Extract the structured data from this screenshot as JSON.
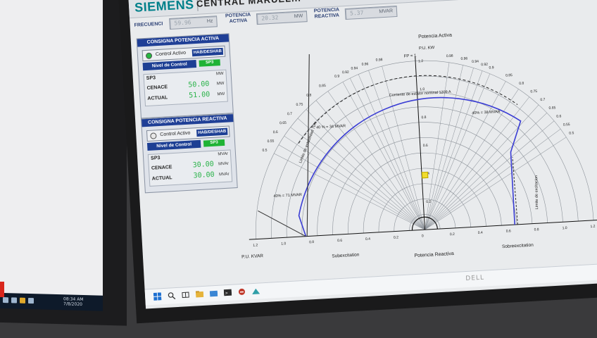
{
  "left_monitor": {
    "taskbar_time": "08:34 AM",
    "taskbar_date": "7/8/2020"
  },
  "header": {
    "brand": "SIEMENS",
    "title": "CENTRAL MARUEL..."
  },
  "measurements": {
    "frecuencia": {
      "label": "FRECUENCI",
      "value": "59.96",
      "unit": "Hz"
    },
    "potencia_activa": {
      "label": "POTENCIA ACTIVA",
      "value": "20.32",
      "unit": "MW"
    },
    "potencia_reactiva": {
      "label": "POTENCIA REACTIVA",
      "value": "5.37",
      "unit": "MVAR"
    }
  },
  "active_power_panel": {
    "title": "CONSIGNA POTENCIA ACTIVA",
    "control_label": "Control Activo",
    "control_on": true,
    "hab_label": "HAB/DESHAB",
    "level_label": "Nivel de Control",
    "level_value": "SP3",
    "sp_label": "SP3",
    "cenace_label": "CENACE",
    "cenace_value": "50.00",
    "actual_label": "ACTUAL",
    "actual_value": "51.00",
    "unit": "MW"
  },
  "reactive_power_panel": {
    "title": "CONSIGNA POTENCIA REACTIVA",
    "control_label": "Control Activo",
    "control_on": false,
    "hab_label": "HAB/DESHAB",
    "level_label": "Nivel de Control",
    "level_value": "SP3",
    "sp_label": "SP3",
    "cenace_label": "CENACE",
    "cenace_value": "30.00",
    "actual_label": "ACTUAL",
    "actual_value": "30.00",
    "unit": "MVAr"
  },
  "chart": {
    "title": "Potencia Activa",
    "y_axis_label": "P.U. KW",
    "fp_label": "FP = 1",
    "x_axis_label": "P.U. KVAR",
    "x_title": "Potencia Reactiva",
    "left_region": "Subexcitation",
    "right_region": "Sobreexcitation",
    "curve_current_label": "Corriente de estator nominal 1209 A",
    "curve_left_label": "40 % = 34 MVAR",
    "curve_right_label": "40% = 38 MVAR",
    "curve_low_label": "40% = 71 MVAR",
    "left_line_label": "Limite de estabilidad 70%",
    "right_line_label": "Limite de excitacion",
    "radial_pf_labels": [
      "0.98",
      "0.96",
      "0.94",
      "0.92",
      "0.9",
      "0.85",
      "0.8",
      "0.75",
      "0.7",
      "0.65",
      "0.6",
      "0.55",
      "0.5"
    ],
    "y_ticks": [
      "0.2",
      "0.4",
      "0.6",
      "0.8",
      "1.0",
      "1.2"
    ],
    "x_ticks": [
      "1.2",
      "1.0",
      "0.8",
      "0.6",
      "0.4",
      "0.2",
      "0",
      "0.2",
      "0.4",
      "0.6",
      "0.8",
      "1.0",
      "1.2"
    ]
  },
  "colors": {
    "curve": "#3a3dd4",
    "panel_header": "#1f3f96",
    "value_green": "#2bb34a",
    "brand": "#00808a"
  },
  "taskbar_icons": [
    "windows-icon",
    "search-icon",
    "task-view-icon",
    "file-explorer-icon",
    "folder-icon",
    "terminal-icon",
    "tool-icon",
    "app-icon"
  ],
  "dell_logo": "DELL"
}
